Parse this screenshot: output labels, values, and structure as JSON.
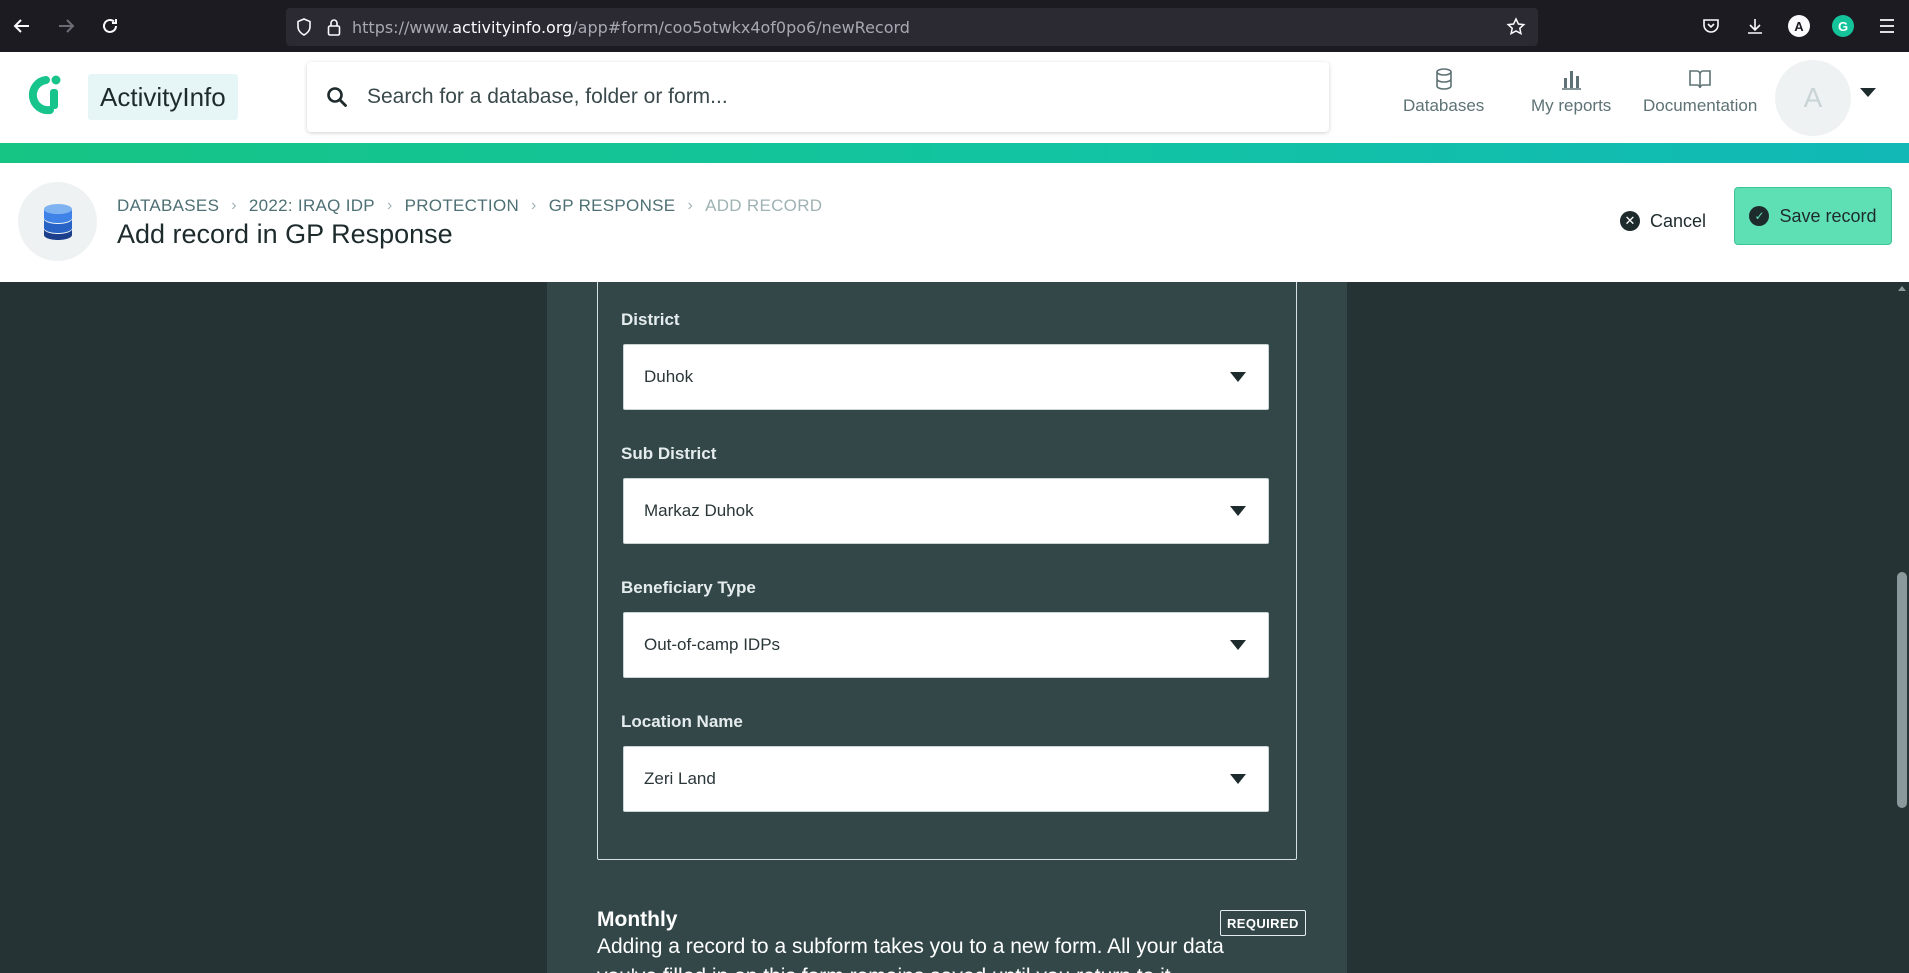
{
  "browser": {
    "url_prefix": "https://www.",
    "url_host": "activityinfo.org",
    "url_path": "/app#form/coo5otwkx4of0po6/newRecord",
    "profile_initial": "A",
    "extension_initial": "G"
  },
  "header": {
    "brand": "ActivityInfo",
    "search_placeholder": "Search for a database, folder or form...",
    "nav": [
      {
        "label": "Databases",
        "icon": "database-icon"
      },
      {
        "label": "My reports",
        "icon": "bar-chart-icon"
      },
      {
        "label": "Documentation",
        "icon": "book-icon"
      }
    ],
    "user_initial": "A"
  },
  "page": {
    "breadcrumb": [
      "DATABASES",
      "2022: IRAQ IDP",
      "PROTECTION",
      "GP RESPONSE",
      "ADD RECORD"
    ],
    "title": "Add record in GP Response",
    "cancel_label": "Cancel",
    "save_label": "Save record"
  },
  "form": {
    "fields": [
      {
        "label": "District",
        "value": "Duhok"
      },
      {
        "label": "Sub District",
        "value": "Markaz Duhok"
      },
      {
        "label": "Beneficiary Type",
        "value": "Out-of-camp IDPs"
      },
      {
        "label": "Location Name",
        "value": "Zeri Land"
      }
    ],
    "subform": {
      "title": "Monthly",
      "badge": "REQUIRED",
      "description": "Adding a record to a subform takes you to a new form. All your data you've filled in on this form remains saved until you return to it."
    }
  },
  "colors": {
    "accent": "#16c484",
    "save_button": "#5fe0b4",
    "page_background": "#263335",
    "form_background": "#334749"
  }
}
